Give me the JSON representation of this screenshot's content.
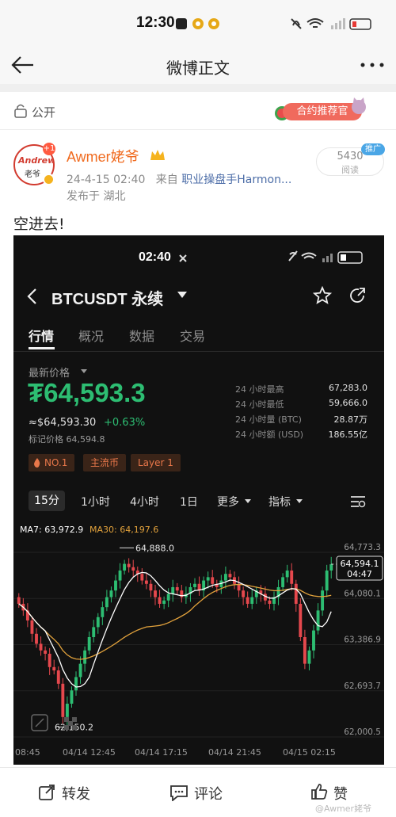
{
  "status_bar": {
    "time": "12:30"
  },
  "nav": {
    "title": "微博正文"
  },
  "visibility": {
    "label": "公开"
  },
  "promo": {
    "label": "合约推荐官"
  },
  "author": {
    "avatar_top": "Andrew",
    "avatar_bottom": "老爷",
    "plus_badge": "+1",
    "name": "Awmer姥爷",
    "date": "24-4-15 02:40",
    "source_prefix": "来自",
    "source": "职业操盘手Harmon...",
    "location": "发布于 湖北"
  },
  "reads": {
    "count": "5430",
    "label": "阅读",
    "promoted": "推广"
  },
  "post": {
    "text": "空进去!"
  },
  "screenshot": {
    "time": "02:40",
    "pair": "BTCUSDT 永续",
    "tabs": [
      "行情",
      "概况",
      "数据",
      "交易"
    ],
    "price_label": "最新价格",
    "price": "₮64,593.3",
    "usd_price": "≈$64,593.30",
    "change": "+0.63%",
    "mark_price": "标记价格  64,594.8",
    "stats": [
      {
        "label": "24 小时最高",
        "value": "67,283.0"
      },
      {
        "label": "24 小时最低",
        "value": "59,666.0"
      },
      {
        "label": "24 小时量 (BTC)",
        "value": "28.87万"
      },
      {
        "label": "24 小时额 (USD)",
        "value": "186.55亿"
      }
    ],
    "tags": [
      "NO.1",
      "主流币",
      "Layer 1"
    ],
    "timeframes": [
      "15分",
      "1小时",
      "4小时",
      "1日",
      "更多",
      "指标"
    ],
    "ma7": "MA7: 63,972.9",
    "ma30": "MA30: 64,197.6",
    "colors": {
      "up": "#2dbd72",
      "down": "#e5484d",
      "ma7": "#ffffff",
      "ma30": "#e2a23c"
    }
  },
  "chart_data": {
    "type": "candlestick",
    "title": "",
    "x_labels": [
      "08:45",
      "04/14 12:45",
      "04/14 17:15",
      "04/14 21:45",
      "04/15 02:15"
    ],
    "y_ticks": [
      "64,773.3",
      "64,080.1",
      "63,386.9",
      "62,693.7",
      "62,000.5"
    ],
    "ylim": [
      62000.5,
      64773.3
    ],
    "annotations": {
      "high": "64,888.0",
      "low": "62,150.2",
      "current": "64,594.1",
      "countdown": "04:47"
    },
    "candles_open": [
      64100,
      64000,
      63900,
      63750,
      63550,
      63400,
      63300,
      63250,
      63050,
      63000,
      62800,
      62300,
      62500,
      62700,
      62900,
      63100,
      63300,
      63500,
      63650,
      63800,
      63950,
      64100,
      64200,
      64350,
      64500,
      64600,
      64550,
      64500,
      64450,
      64350,
      64300,
      64200,
      64100,
      64000,
      64050,
      64150,
      64250,
      64200,
      64100,
      64150,
      64250,
      64300,
      64200,
      64350,
      64400,
      64300,
      64250,
      64350,
      64450,
      64400,
      64300,
      64200,
      64100,
      64000,
      64100,
      64200,
      64150,
      64050,
      64000,
      64100,
      64250,
      64400,
      64500,
      64300,
      64000,
      63500,
      63100,
      63300,
      63600,
      63900,
      64200,
      64500
    ],
    "candles_close": [
      64000,
      63900,
      63750,
      63550,
      63400,
      63300,
      63250,
      63050,
      63000,
      62800,
      62300,
      62500,
      62700,
      62900,
      63100,
      63300,
      63500,
      63650,
      63800,
      63950,
      64100,
      64200,
      64350,
      64500,
      64600,
      64550,
      64500,
      64450,
      64350,
      64300,
      64200,
      64100,
      64000,
      64050,
      64150,
      64250,
      64200,
      64100,
      64150,
      64250,
      64300,
      64200,
      64350,
      64400,
      64300,
      64250,
      64350,
      64450,
      64400,
      64300,
      64200,
      64100,
      64000,
      64100,
      64200,
      64150,
      64050,
      64000,
      64100,
      64250,
      64400,
      64500,
      64300,
      64000,
      63500,
      63100,
      63300,
      63600,
      63900,
      64200,
      64500,
      64594
    ]
  },
  "bottom_bar": {
    "repost": "转发",
    "comment": "评论",
    "like": "赞"
  },
  "watermark": "@Awmer姥爷"
}
